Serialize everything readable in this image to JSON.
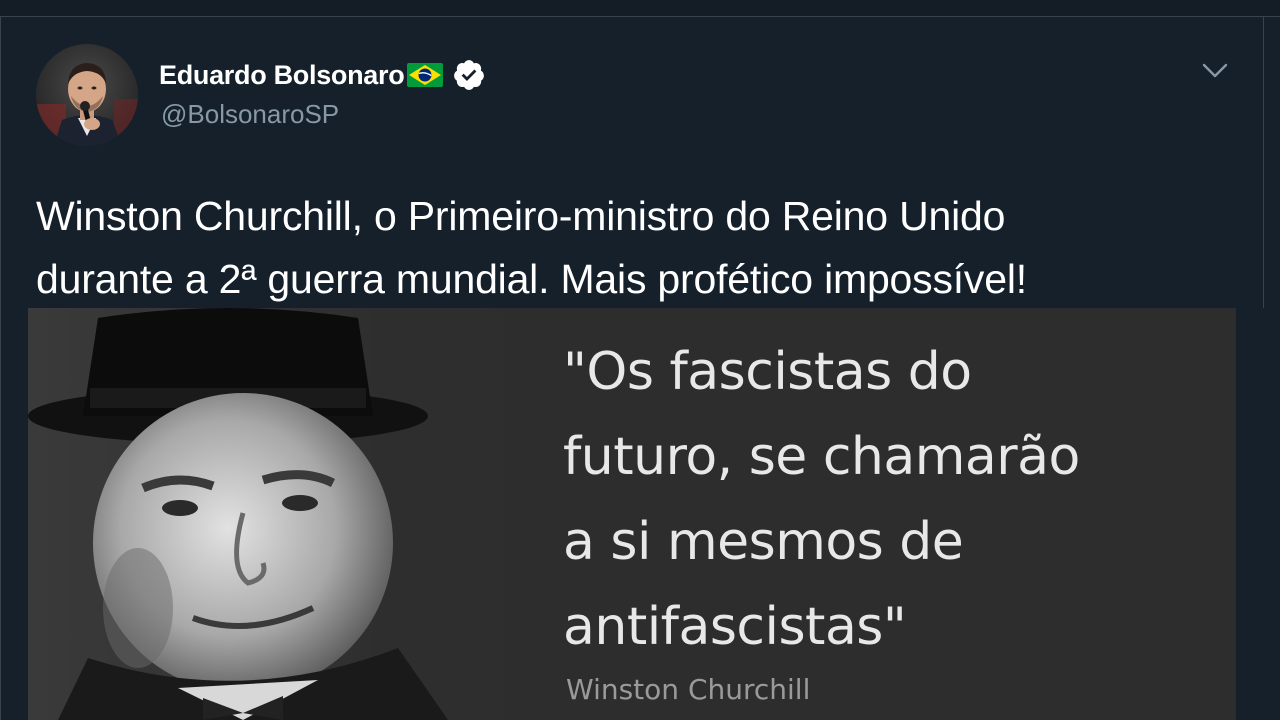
{
  "tweet": {
    "author_name": "Eduardo Bolsonaro",
    "author_handle": "@BolsonaroSP",
    "flag_icon": "brazil-flag-emoji",
    "verified_icon": "verified-badge-icon",
    "menu_icon": "chevron-down-icon",
    "text_line1": "Winston Churchill, o Primeiro-ministro do Reino Unido",
    "text_line2": "durante a 2ª guerra mundial. Mais profético impossível!",
    "media": {
      "quote_line1": "\"Os fascistas do",
      "quote_line2": "futuro, se chamarão",
      "quote_line3": "a si mesmos de",
      "quote_line4": "antifascistas\"",
      "quote_author": "Winston Churchill"
    }
  },
  "colors": {
    "background": "#15202b",
    "text_primary": "#ffffff",
    "text_secondary": "#8899a6",
    "border": "#38444d",
    "flag_green": "#009c3b",
    "flag_yellow": "#ffdf00",
    "flag_blue": "#002776"
  }
}
